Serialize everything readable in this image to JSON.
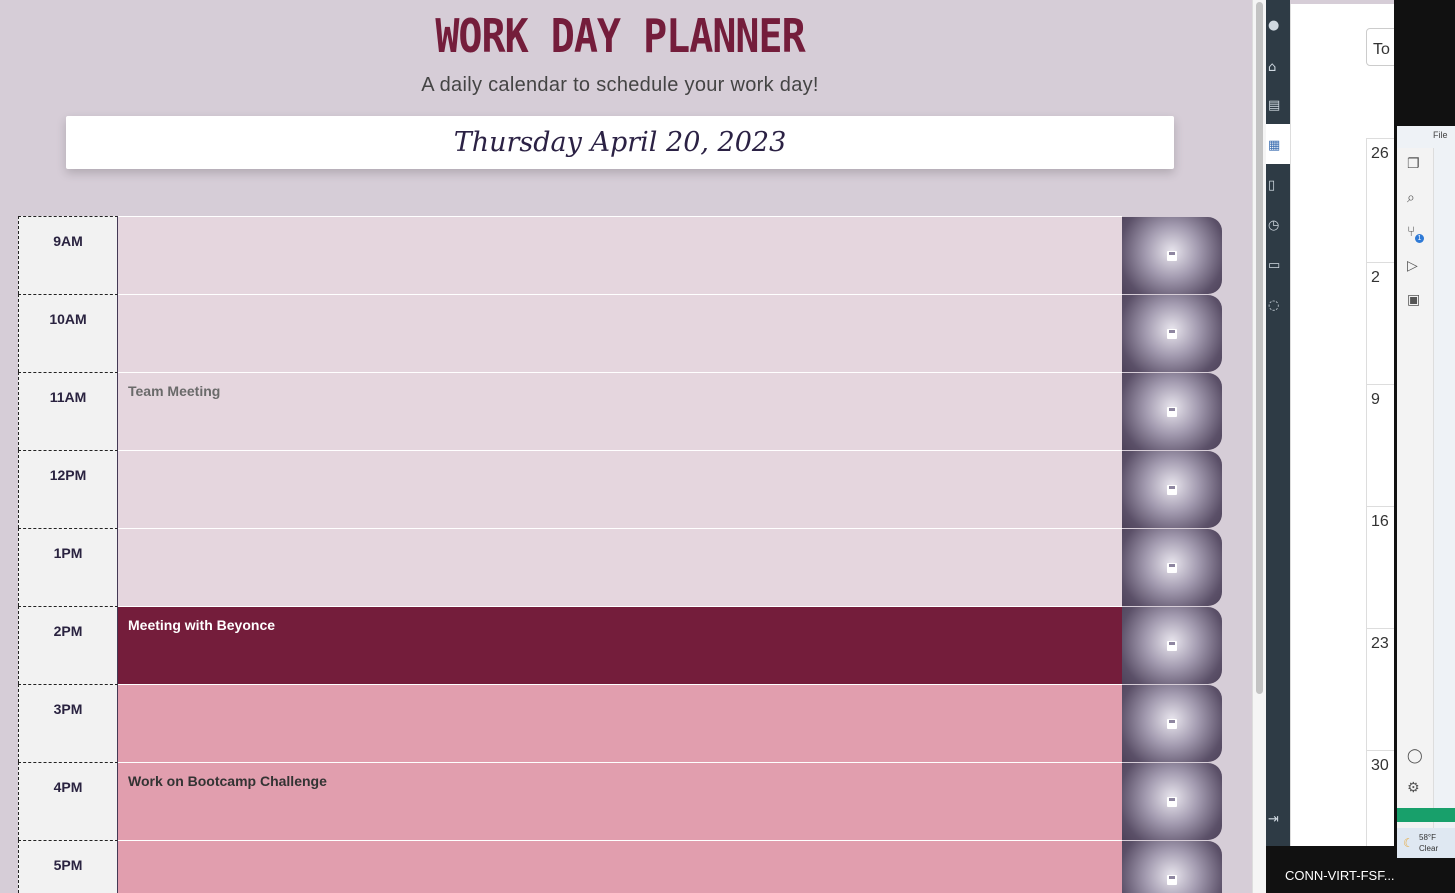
{
  "header": {
    "title": "Work Day Planner",
    "subtitle": "A daily calendar to schedule your work day!",
    "current_date": "Thursday April 20, 2023"
  },
  "hours": [
    {
      "label": "9AM",
      "text": "",
      "state": "past"
    },
    {
      "label": "10AM",
      "text": "",
      "state": "past"
    },
    {
      "label": "11AM",
      "text": "Team Meeting",
      "state": "past"
    },
    {
      "label": "12PM",
      "text": "",
      "state": "past"
    },
    {
      "label": "1PM",
      "text": "",
      "state": "past"
    },
    {
      "label": "2PM",
      "text": "Meeting with Beyonce",
      "state": "present"
    },
    {
      "label": "3PM",
      "text": "",
      "state": "future"
    },
    {
      "label": "4PM",
      "text": "Work on Bootcamp Challenge",
      "state": "future"
    },
    {
      "label": "5PM",
      "text": "",
      "state": "future"
    }
  ],
  "colors": {
    "past": "#e5d6de",
    "present": "#741d3b",
    "future": "#e19eae",
    "title": "#741d3b",
    "page_bg": "#d6cdd7"
  },
  "icons": {
    "save": "floppy-disk-icon"
  },
  "background_windows": {
    "calendar_button": "To",
    "calendar_days": [
      "26",
      "2",
      "9",
      "16",
      "23",
      "30"
    ],
    "taskbar_label": "CONN-VIRT-FSF...",
    "vscode_menu": "File",
    "vscode_badge": "1",
    "weather_temp": "58°F",
    "weather_desc": "Clear"
  }
}
